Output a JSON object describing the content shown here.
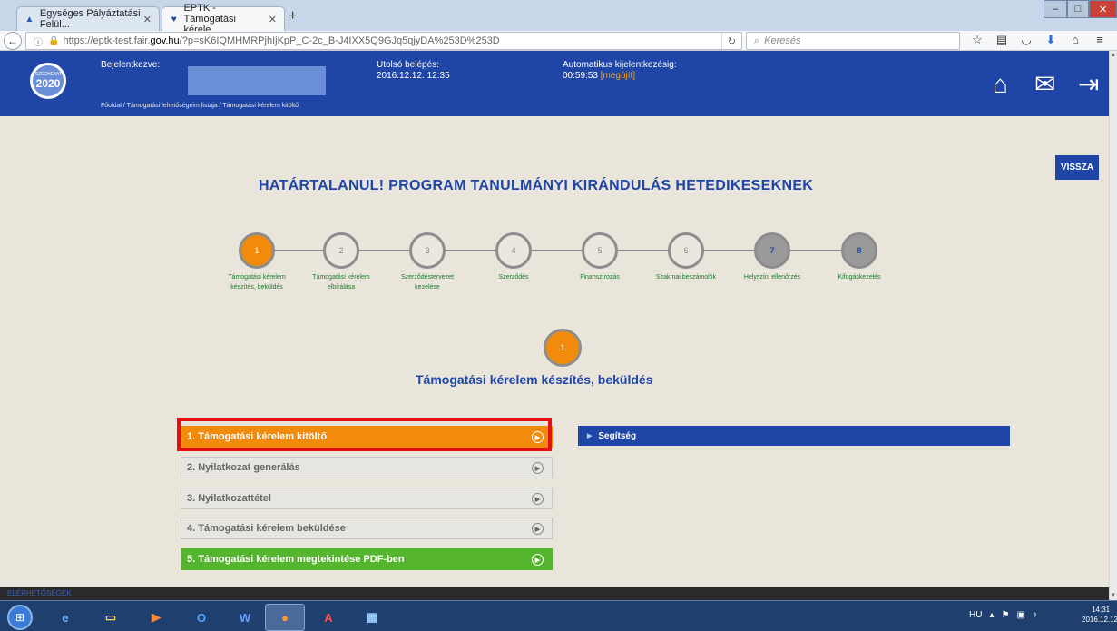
{
  "browser": {
    "tabs": [
      {
        "title": "Egységes Pályáztatási Felül...",
        "icon": "gov-icon"
      },
      {
        "title": "EPTK - Támogatási kérele...",
        "icon": "heart-icon"
      }
    ],
    "url_prefix": "https://eptk-test.fair.",
    "url_domain": "gov.hu",
    "url_rest": "/?p=sK6IQMHMRPjhIjKpP_C-2c_B-J4IXX5Q9GJq5qjyDA%253D%253D",
    "search_placeholder": "Keresés"
  },
  "header": {
    "logged_in_label": "Bejelentkezve:",
    "last_login_label": "Utolsó belépés:",
    "last_login_value": "2016.12.12. 12:35",
    "auto_logout_label": "Automatikus kijelentkezésig:",
    "auto_logout_time": "00:59:53",
    "renew_label": "[megújít]",
    "breadcrumbs": "Főoldal  /  Támogatási lehetőségeim listája  /  Támogatási kérelem kitöltő"
  },
  "page": {
    "back_button": "VISSZA",
    "title": "HATÁRTALANUL! PROGRAM TANULMÁNYI KIRÁNDULÁS HETEDIKESEKNEK",
    "steps": [
      {
        "num": "1",
        "label_1": "Támogatási kérelem",
        "label_2": "készítés, beküldés"
      },
      {
        "num": "2",
        "label_1": "Támogatási kérelem",
        "label_2": "elbírálása"
      },
      {
        "num": "3",
        "label_1": "Szerződéstervezet",
        "label_2": "kezelése"
      },
      {
        "num": "4",
        "label_1": "Szerződés",
        "label_2": ""
      },
      {
        "num": "5",
        "label_1": "Finanszírozás",
        "label_2": ""
      },
      {
        "num": "6",
        "label_1": "Szakmai beszámolók",
        "label_2": ""
      },
      {
        "num": "7",
        "label_1": "Helyszíni ellenőrzés",
        "label_2": ""
      },
      {
        "num": "8",
        "label_1": "Kifogáskezelés",
        "label_2": ""
      }
    ],
    "current_step_number": "1",
    "section_title": "Támogatási kérelem készítés, beküldés",
    "menu": [
      "1. Támogatási kérelem kitöltő",
      "2. Nyilatkozat generálás",
      "3. Nyilatkozattétel",
      "4. Támogatási kérelem beküldése",
      "5. Támogatási kérelem megtekintése PDF-ben"
    ],
    "help_label": "Segítség"
  },
  "footer": {
    "contacts": "ELÉRHETŐSÉGEK"
  },
  "taskbar": {
    "lang": "HU",
    "time": "14:31",
    "date": "2016.12.12."
  },
  "colors": {
    "brand_blue": "#1f46a6",
    "orange": "#f28a0c",
    "green": "#56b52e",
    "highlight_red": "#e41010"
  }
}
